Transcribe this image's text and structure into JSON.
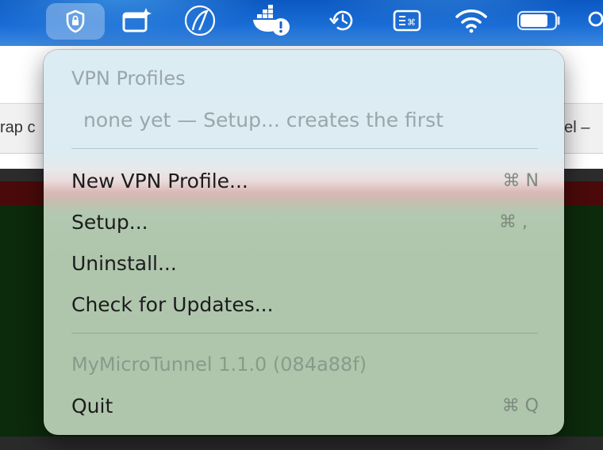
{
  "menubar": {
    "icons": [
      {
        "name": "vpn-shield-icon",
        "active": true
      },
      {
        "name": "window-sparkle-icon"
      },
      {
        "name": "swirl-app-icon"
      },
      {
        "name": "docker-warning-icon"
      },
      {
        "name": "time-machine-icon"
      },
      {
        "name": "keyboard-menu-icon"
      },
      {
        "name": "wifi-icon"
      },
      {
        "name": "battery-icon"
      },
      {
        "name": "search-icon"
      }
    ]
  },
  "background_window": {
    "left_text": "rap c",
    "right_text": "nel –"
  },
  "menu": {
    "section_header": "VPN Profiles",
    "empty_note": "none yet — Setup... creates the first",
    "items": [
      {
        "label": "New VPN Profile...",
        "shortcut": "⌘ N"
      },
      {
        "label": "Setup...",
        "shortcut": "⌘ ,"
      },
      {
        "label": "Uninstall...",
        "shortcut": ""
      },
      {
        "label": "Check for Updates...",
        "shortcut": ""
      }
    ],
    "version": "MyMicroTunnel 1.1.0 (084a88f)",
    "quit": {
      "label": "Quit",
      "shortcut": "⌘ Q"
    }
  }
}
